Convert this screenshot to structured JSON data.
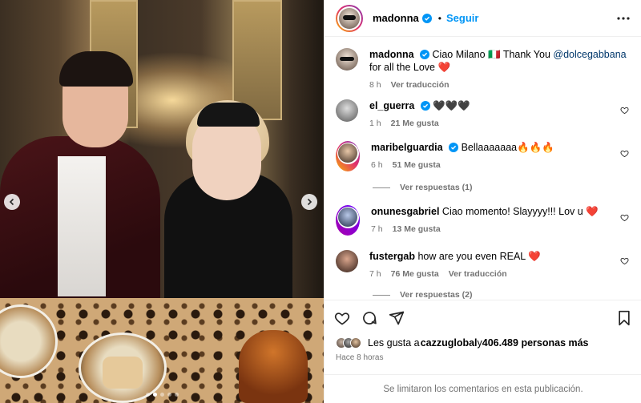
{
  "post": {
    "username": "madonna",
    "follow_label": "Seguir",
    "separator": "•"
  },
  "photo": {
    "prev_label": "previous image",
    "next_label": "next image",
    "carousel_count": 5,
    "carousel_active": 1
  },
  "caption": {
    "username": "madonna",
    "text_pre": "Ciao Milano 🇮🇹 Thank You ",
    "mention": "@dolcegabbana",
    "text_post": " for all the Love ❤️",
    "time": "8 h",
    "translate": "Ver traducción"
  },
  "comments": [
    {
      "username": "el_guerra",
      "verified": true,
      "text": "🖤🖤🖤",
      "time": "1 h",
      "likes": "21 Me gusta",
      "translate": ""
    },
    {
      "username": "maribelguardia",
      "verified": true,
      "text": "Bellaaaaaaa🔥🔥🔥",
      "time": "6 h",
      "likes": "51 Me gusta",
      "translate": "",
      "replies": "Ver respuestas (1)"
    },
    {
      "username": "onunesgabriel",
      "verified": false,
      "text": "Ciao momento! Slayyyy!!! Lov u ❤️",
      "time": "7 h",
      "likes": "13 Me gusta",
      "translate": ""
    },
    {
      "username": "fustergab",
      "verified": false,
      "text": "how are you even REAL ❤️",
      "time": "7 h",
      "likes": "76 Me gusta",
      "translate": "Ver traducción",
      "replies": "Ver respuestas (2)"
    }
  ],
  "likes": {
    "prefix": "Les gusta a ",
    "user": "cazzuglobal",
    "mid": " y ",
    "count": "406.489 personas más"
  },
  "posted": "Hace 8 horas",
  "footer": "Se limitaron los comentarios en esta publicación.",
  "icons": {
    "verified": "verified-badge-icon",
    "more": "more-options-icon",
    "like": "heart-icon",
    "comment": "comment-icon",
    "share": "share-icon",
    "save": "bookmark-icon"
  },
  "colors": {
    "accent": "#0095f6",
    "verified": "#0095f6",
    "muted": "#737373",
    "mention": "#00376b"
  }
}
